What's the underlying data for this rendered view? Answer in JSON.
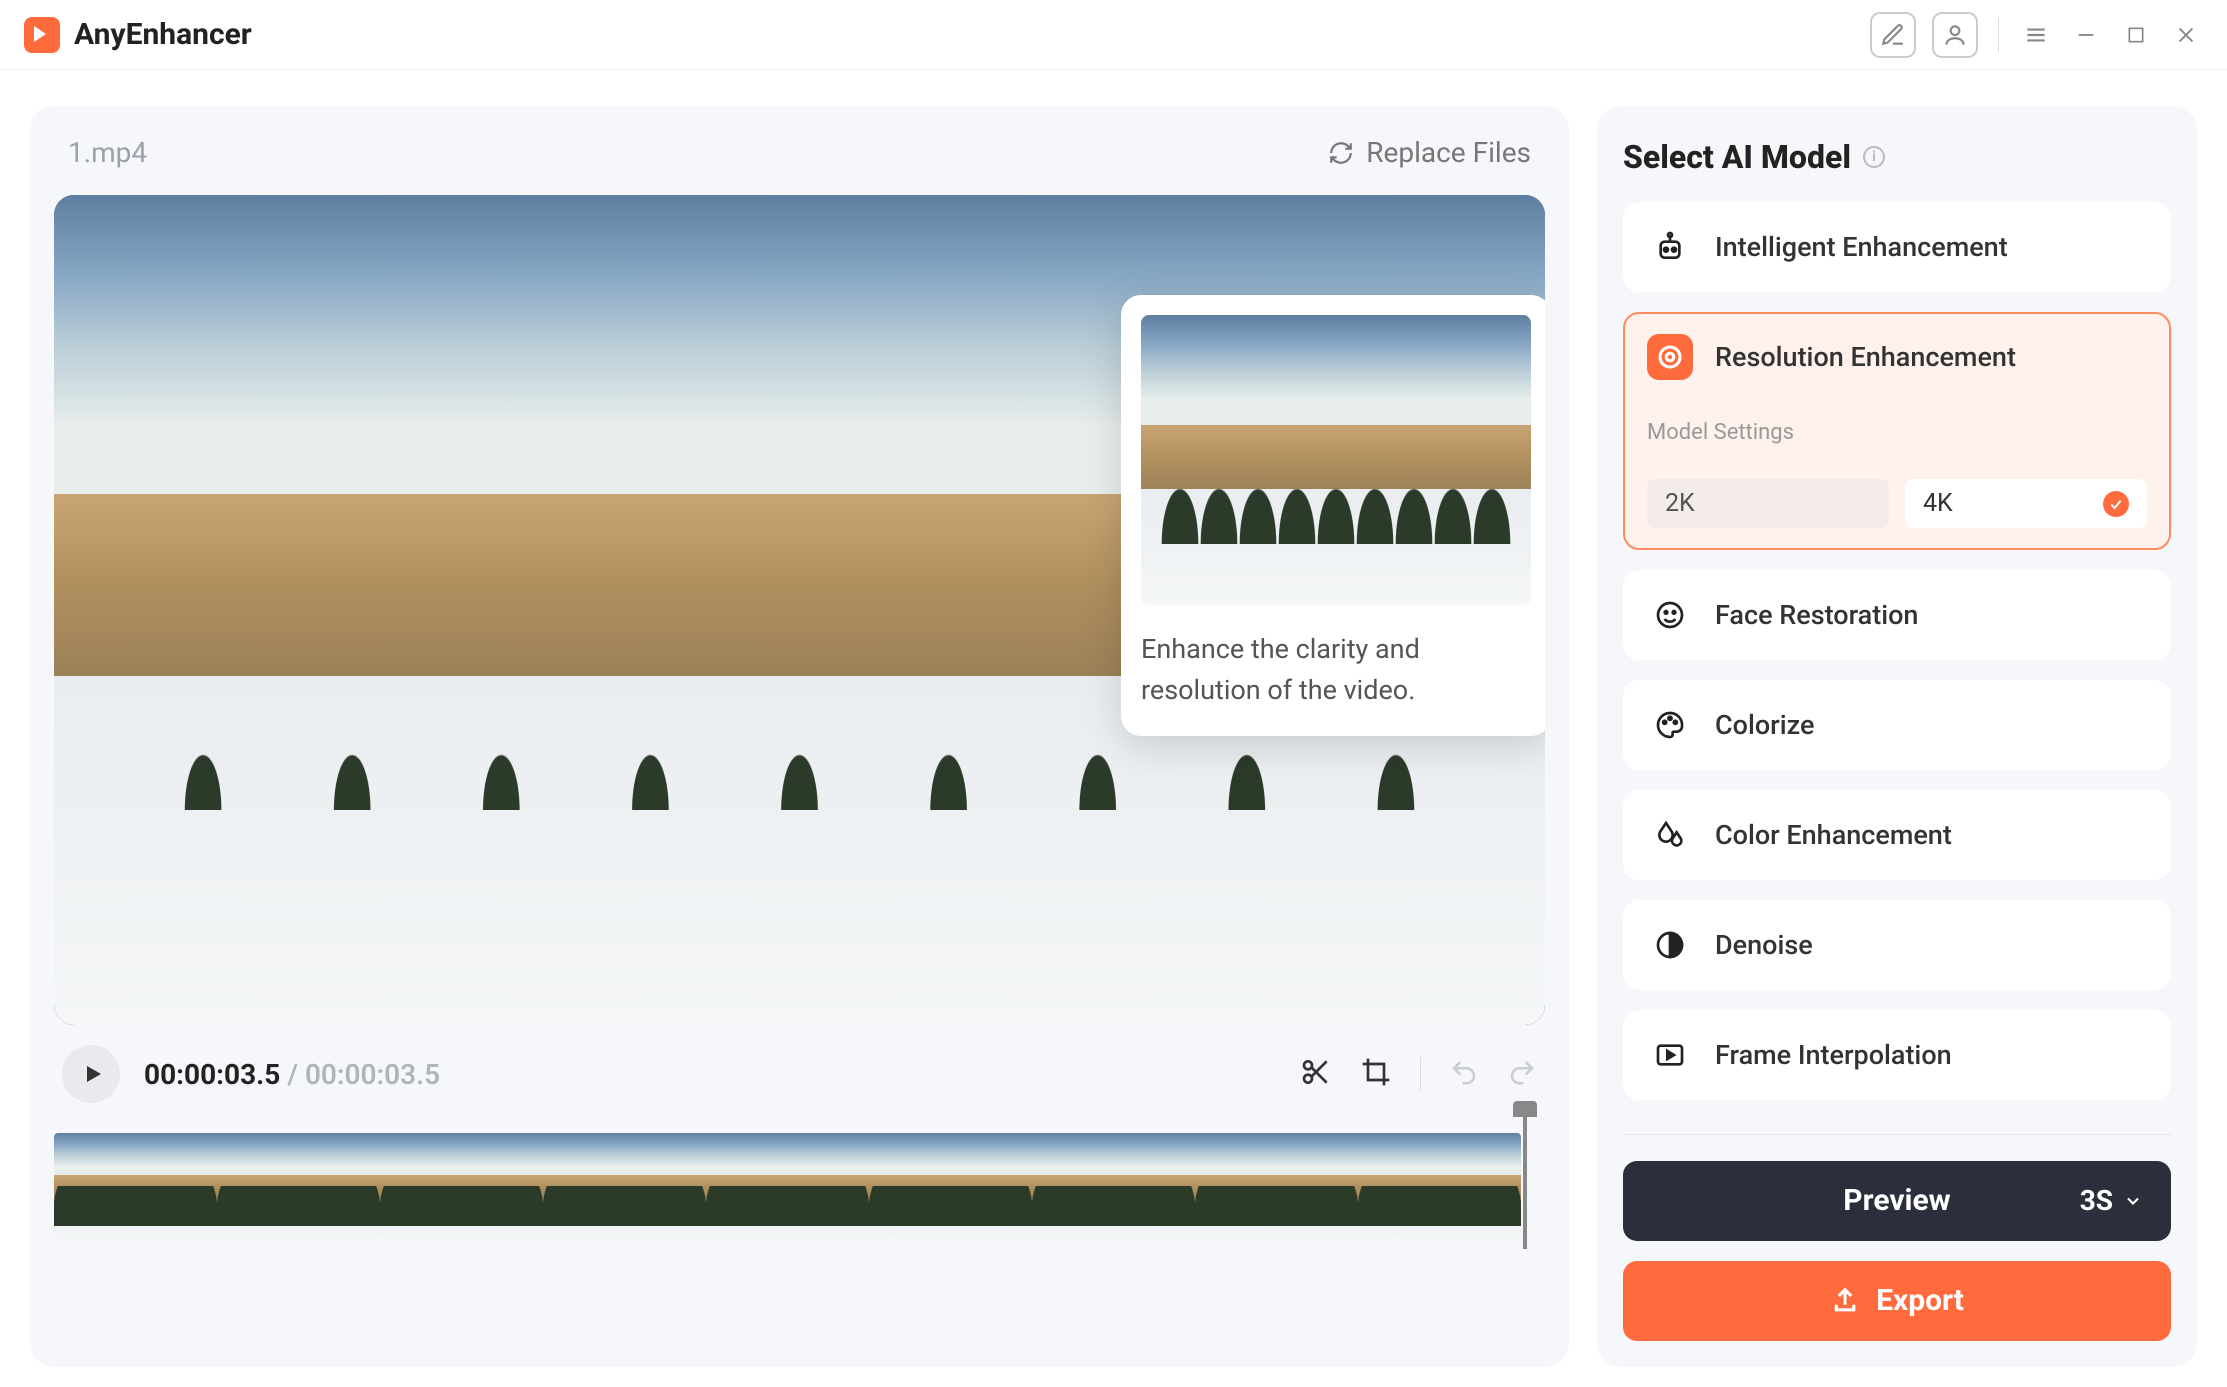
{
  "app": {
    "title": "AnyEnhancer"
  },
  "video": {
    "filename": "1.mp4",
    "replace_label": "Replace Files",
    "current_time": "00:00:03.5",
    "total_time": "00:00:03.5"
  },
  "tooltip": {
    "text": "Enhance the clarity and resolution of the video."
  },
  "sidebar": {
    "title": "Select AI Model",
    "models": [
      {
        "label": "Intelligent Enhancement"
      },
      {
        "label": "Resolution Enhancement"
      },
      {
        "label": "Face Restoration"
      },
      {
        "label": "Colorize"
      },
      {
        "label": "Color Enhancement"
      },
      {
        "label": "Denoise"
      },
      {
        "label": "Frame Interpolation"
      }
    ],
    "settings_label": "Model Settings",
    "resolution_options": {
      "opt1": "2K",
      "opt2": "4K",
      "selected": "4K"
    }
  },
  "actions": {
    "preview_label": "Preview",
    "preview_duration": "3S",
    "export_label": "Export"
  }
}
